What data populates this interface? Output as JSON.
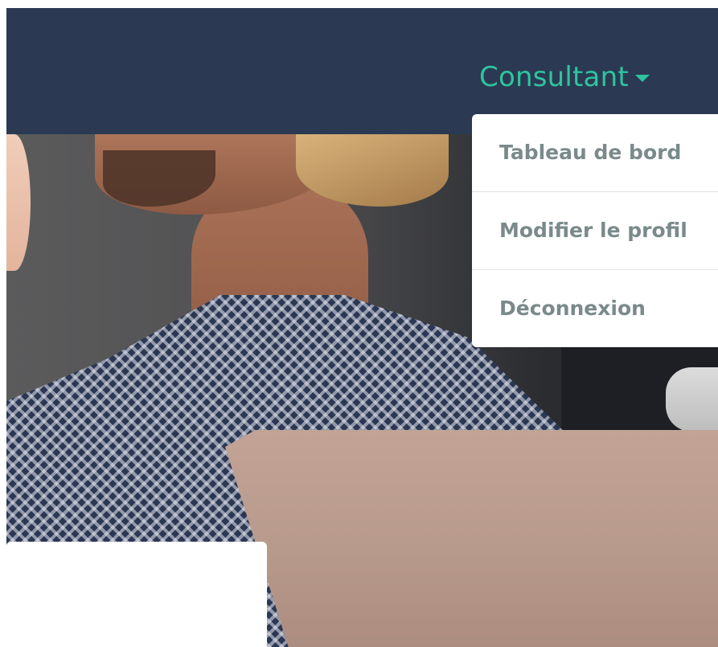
{
  "navbar": {
    "dropdown_label": "Consultant"
  },
  "dropdown_menu": {
    "items": [
      {
        "label": "Tableau de bord"
      },
      {
        "label": "Modifier le profil"
      },
      {
        "label": "Déconnexion"
      }
    ]
  },
  "colors": {
    "navbar_bg": "#2b3a52",
    "accent": "#2ec4a0",
    "menu_text": "#7a8a8a"
  }
}
